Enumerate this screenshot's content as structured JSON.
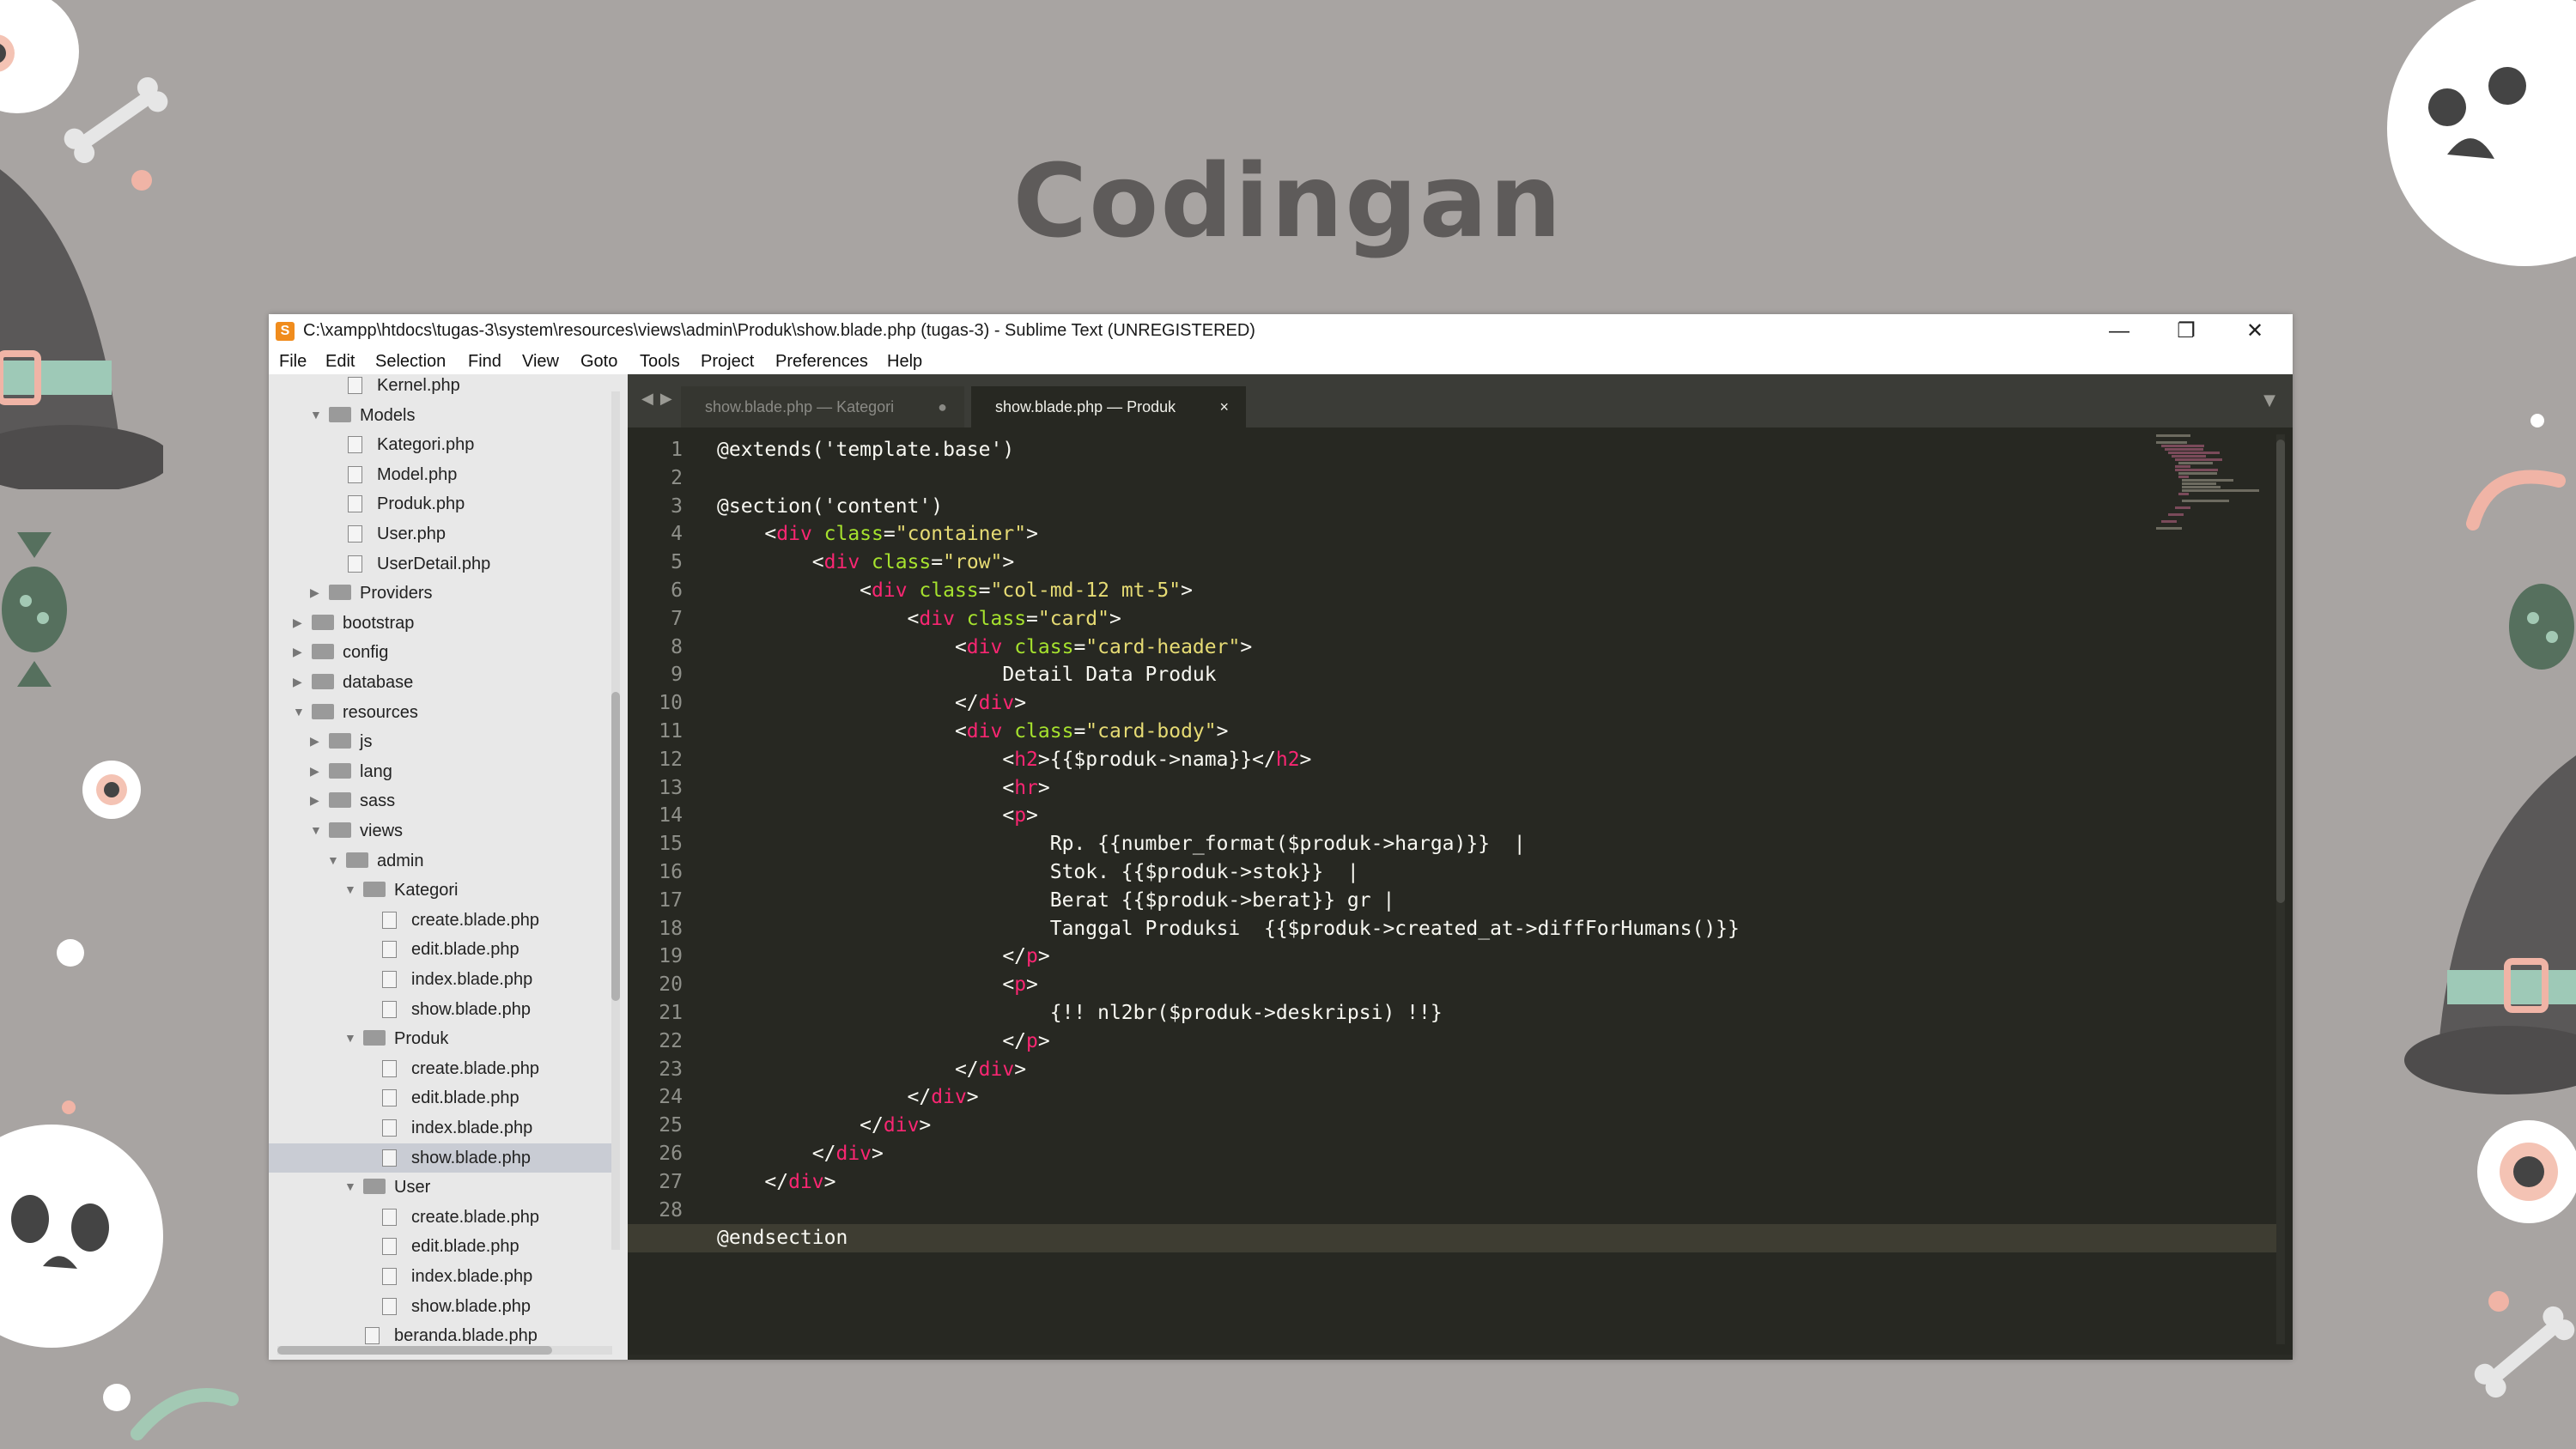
{
  "slide": {
    "title": "Codingan"
  },
  "window": {
    "title": "C:\\xampp\\htdocs\\tugas-3\\system\\resources\\views\\admin\\Produk\\show.blade.php (tugas-3) - Sublime Text (UNREGISTERED)",
    "app_icon": "S",
    "minimize_icon": "minimize-icon",
    "restore_icon": "restore-icon",
    "close_icon": "close-icon"
  },
  "menu": [
    "File",
    "Edit",
    "Selection",
    "Find",
    "View",
    "Goto",
    "Tools",
    "Project",
    "Preferences",
    "Help"
  ],
  "sidebar": {
    "items": [
      {
        "label": "Kernel.php",
        "type": "file",
        "depth": 3
      },
      {
        "label": "Models",
        "type": "folder",
        "depth": 2,
        "open": true
      },
      {
        "label": "Kategori.php",
        "type": "file",
        "depth": 3
      },
      {
        "label": "Model.php",
        "type": "file",
        "depth": 3
      },
      {
        "label": "Produk.php",
        "type": "file",
        "depth": 3
      },
      {
        "label": "User.php",
        "type": "file",
        "depth": 3
      },
      {
        "label": "UserDetail.php",
        "type": "file",
        "depth": 3
      },
      {
        "label": "Providers",
        "type": "folder",
        "depth": 2,
        "open": false
      },
      {
        "label": "bootstrap",
        "type": "folder",
        "depth": 1,
        "open": false
      },
      {
        "label": "config",
        "type": "folder",
        "depth": 1,
        "open": false
      },
      {
        "label": "database",
        "type": "folder",
        "depth": 1,
        "open": false
      },
      {
        "label": "resources",
        "type": "folder",
        "depth": 1,
        "open": true
      },
      {
        "label": "js",
        "type": "folder",
        "depth": 2,
        "open": false
      },
      {
        "label": "lang",
        "type": "folder",
        "depth": 2,
        "open": false
      },
      {
        "label": "sass",
        "type": "folder",
        "depth": 2,
        "open": false
      },
      {
        "label": "views",
        "type": "folder",
        "depth": 2,
        "open": true
      },
      {
        "label": "admin",
        "type": "folder",
        "depth": 3,
        "open": true
      },
      {
        "label": "Kategori",
        "type": "folder",
        "depth": 4,
        "open": true
      },
      {
        "label": "create.blade.php",
        "type": "file",
        "depth": 5
      },
      {
        "label": "edit.blade.php",
        "type": "file",
        "depth": 5
      },
      {
        "label": "index.blade.php",
        "type": "file",
        "depth": 5
      },
      {
        "label": "show.blade.php",
        "type": "file",
        "depth": 5
      },
      {
        "label": "Produk",
        "type": "folder",
        "depth": 4,
        "open": true
      },
      {
        "label": "create.blade.php",
        "type": "file",
        "depth": 5
      },
      {
        "label": "edit.blade.php",
        "type": "file",
        "depth": 5
      },
      {
        "label": "index.blade.php",
        "type": "file",
        "depth": 5
      },
      {
        "label": "show.blade.php",
        "type": "file",
        "depth": 5,
        "selected": true
      },
      {
        "label": "User",
        "type": "folder",
        "depth": 4,
        "open": true
      },
      {
        "label": "create.blade.php",
        "type": "file",
        "depth": 5
      },
      {
        "label": "edit.blade.php",
        "type": "file",
        "depth": 5
      },
      {
        "label": "index.blade.php",
        "type": "file",
        "depth": 5
      },
      {
        "label": "show.blade.php",
        "type": "file",
        "depth": 5
      },
      {
        "label": "beranda.blade.php",
        "type": "file",
        "depth": 4
      }
    ]
  },
  "tabs": [
    {
      "label": "show.blade.php — Kategori",
      "active": false,
      "close": "●"
    },
    {
      "label": "show.blade.php — Produk",
      "active": true,
      "close": "×"
    }
  ],
  "code": {
    "current_line": 29,
    "lines": [
      [
        [
          "p",
          "@extends('template.base')"
        ]
      ],
      [],
      [
        [
          "p",
          "@section('content')"
        ]
      ],
      [
        [
          "p",
          "    <"
        ],
        [
          "t",
          "div"
        ],
        [
          "a",
          " class"
        ],
        [
          "p",
          "="
        ],
        [
          "s",
          "\"container\""
        ],
        [
          "p",
          ">"
        ]
      ],
      [
        [
          "p",
          "        <"
        ],
        [
          "t",
          "div"
        ],
        [
          "a",
          " class"
        ],
        [
          "p",
          "="
        ],
        [
          "s",
          "\"row\""
        ],
        [
          "p",
          ">"
        ]
      ],
      [
        [
          "p",
          "            <"
        ],
        [
          "t",
          "div"
        ],
        [
          "a",
          " class"
        ],
        [
          "p",
          "="
        ],
        [
          "s",
          "\"col-md-12 mt-5\""
        ],
        [
          "p",
          ">"
        ]
      ],
      [
        [
          "p",
          "                <"
        ],
        [
          "t",
          "div"
        ],
        [
          "a",
          " class"
        ],
        [
          "p",
          "="
        ],
        [
          "s",
          "\"card\""
        ],
        [
          "p",
          ">"
        ]
      ],
      [
        [
          "p",
          "                    <"
        ],
        [
          "t",
          "div"
        ],
        [
          "a",
          " class"
        ],
        [
          "p",
          "="
        ],
        [
          "s",
          "\"card-header\""
        ],
        [
          "p",
          ">"
        ]
      ],
      [
        [
          "p",
          "                        Detail Data Produk"
        ]
      ],
      [
        [
          "p",
          "                    </"
        ],
        [
          "t",
          "div"
        ],
        [
          "p",
          ">"
        ]
      ],
      [
        [
          "p",
          "                    <"
        ],
        [
          "t",
          "div"
        ],
        [
          "a",
          " class"
        ],
        [
          "p",
          "="
        ],
        [
          "s",
          "\"card-body\""
        ],
        [
          "p",
          ">"
        ]
      ],
      [
        [
          "p",
          "                        <"
        ],
        [
          "t",
          "h2"
        ],
        [
          "p",
          ">{{$produk->nama}}</"
        ],
        [
          "t",
          "h2"
        ],
        [
          "p",
          ">"
        ]
      ],
      [
        [
          "p",
          "                        <"
        ],
        [
          "t",
          "hr"
        ],
        [
          "p",
          ">"
        ]
      ],
      [
        [
          "p",
          "                        <"
        ],
        [
          "t",
          "p"
        ],
        [
          "p",
          ">"
        ]
      ],
      [
        [
          "p",
          "                            Rp. {{number_format($produk->harga)}}  |"
        ]
      ],
      [
        [
          "p",
          "                            Stok. {{$produk->stok}}  |"
        ]
      ],
      [
        [
          "p",
          "                            Berat {{$produk->berat}} gr |"
        ]
      ],
      [
        [
          "p",
          "                            Tanggal Produksi  {{$produk->created_at->diffForHumans()}}"
        ]
      ],
      [
        [
          "p",
          "                        </"
        ],
        [
          "t",
          "p"
        ],
        [
          "p",
          ">"
        ]
      ],
      [
        [
          "p",
          "                        <"
        ],
        [
          "t",
          "p"
        ],
        [
          "p",
          ">"
        ]
      ],
      [
        [
          "p",
          "                            {!! nl2br($produk->deskripsi) !!}"
        ]
      ],
      [
        [
          "p",
          "                        </"
        ],
        [
          "t",
          "p"
        ],
        [
          "p",
          ">"
        ]
      ],
      [
        [
          "p",
          "                    </"
        ],
        [
          "t",
          "div"
        ],
        [
          "p",
          ">"
        ]
      ],
      [
        [
          "p",
          "                </"
        ],
        [
          "t",
          "div"
        ],
        [
          "p",
          ">"
        ]
      ],
      [
        [
          "p",
          "            </"
        ],
        [
          "t",
          "div"
        ],
        [
          "p",
          ">"
        ]
      ],
      [
        [
          "p",
          "        </"
        ],
        [
          "t",
          "div"
        ],
        [
          "p",
          ">"
        ]
      ],
      [
        [
          "p",
          "    </"
        ],
        [
          "t",
          "div"
        ],
        [
          "p",
          ">"
        ]
      ],
      [],
      [
        [
          "p",
          "@endsection"
        ]
      ]
    ]
  },
  "colors": {
    "background": "#a8a4a2",
    "editor_bg": "#272822",
    "tag": "#f92672",
    "attr": "#a6e22e",
    "string": "#e6db74",
    "text": "#f8f8f2",
    "line_number": "#8f908a",
    "sidebar_bg": "#e8e8e8"
  }
}
